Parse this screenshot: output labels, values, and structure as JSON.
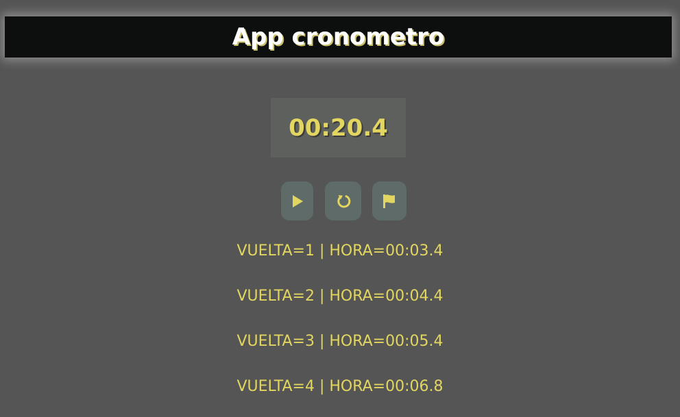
{
  "app": {
    "title": "App cronometro"
  },
  "timer": {
    "display": "00:20.4"
  },
  "controls": [
    {
      "name": "play-button",
      "icon": "play-icon"
    },
    {
      "name": "reset-button",
      "icon": "refresh-icon"
    },
    {
      "name": "lap-button",
      "icon": "flag-icon"
    }
  ],
  "laps": [
    "VUELTA=1 | HORA=00:03.4",
    "VUELTA=2 | HORA=00:04.4",
    "VUELTA=3 | HORA=00:05.4",
    "VUELTA=4 | HORA=00:06.8"
  ],
  "colors": {
    "background": "#555555",
    "header": "#0d0e0e",
    "accent": "#e2d660",
    "button": "#5e6b68",
    "display": "#5d605d"
  }
}
